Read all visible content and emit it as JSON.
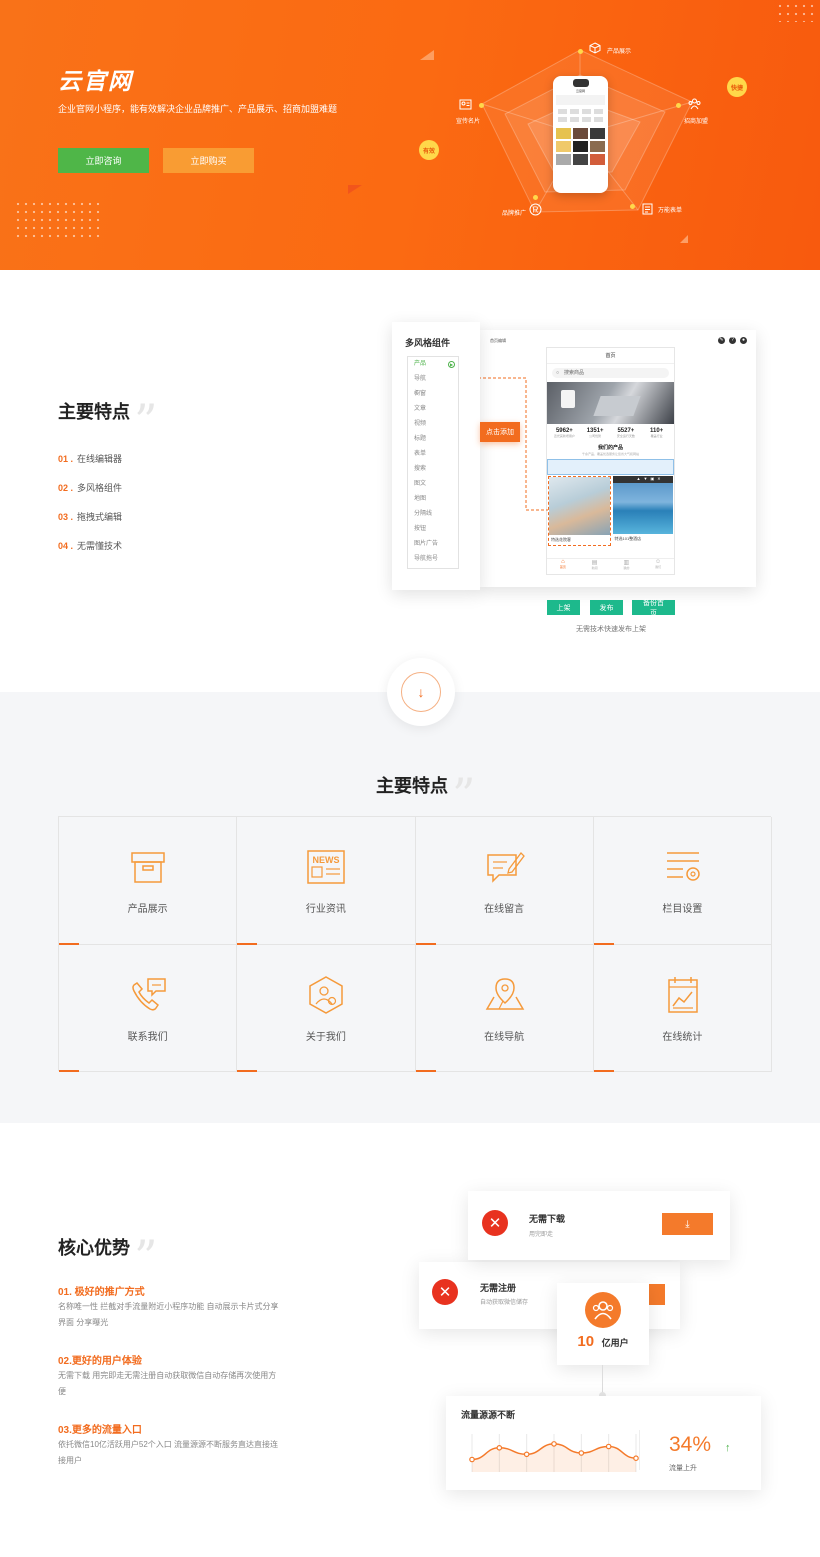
{
  "hero": {
    "brand": "云官网",
    "description": "企业官网小程序，能有效解决企业品牌推广、产品展示、招商加盟难题",
    "consult_label": "立即咨询",
    "buy_label": "立即购买",
    "radar_labels": {
      "product": "产品展示",
      "invest": "招商加盟",
      "form": "万能表单",
      "brand": "品牌推广",
      "card": "宣传名片"
    },
    "badge_fast": "快捷",
    "badge_effective": "有效",
    "phone_title": "云官网"
  },
  "features": {
    "title": "主要特点",
    "items": [
      {
        "num": "01 .",
        "text": "在线编辑器"
      },
      {
        "num": "02 .",
        "text": "多风格组件"
      },
      {
        "num": "03 .",
        "text": "拖拽式编辑"
      },
      {
        "num": "04 .",
        "text": "无需懂技术"
      }
    ]
  },
  "editor": {
    "panel_title": "多风格组件",
    "components": [
      "产品",
      "导航",
      "橱窗",
      "文章",
      "视频",
      "标题",
      "表单",
      "搜索",
      "图文",
      "地图",
      "分隔线",
      "按钮",
      "图片广告",
      "导航拖号"
    ],
    "add_button": "点击添加",
    "toolbar_title": "首页编辑",
    "phone_title": "首页",
    "search_placeholder": "搜索商品",
    "stats": [
      {
        "value": "5962+",
        "label": "近光亮新增用户"
      },
      {
        "value": "1351+",
        "label": "公司优势"
      },
      {
        "value": "5527+",
        "label": "安全运行天数"
      },
      {
        "value": "110+",
        "label": "覆盖行业"
      }
    ],
    "products_title": "我们的产品",
    "products_sub": "千余产品，覆盖优选服务让您省大气和网站",
    "product_names": [
      "特选花院客",
      "特选101整酒店"
    ],
    "tabs": [
      "首页",
      "新闻",
      "我的",
      "我们"
    ],
    "btn_shelf": "上架",
    "btn_publish": "发布",
    "btn_backup": "备份首页",
    "caption": "无需技术快速发布上架"
  },
  "grid": {
    "title": "主要特点",
    "cells": [
      "产品展示",
      "行业资讯",
      "在线留言",
      "栏目设置",
      "联系我们",
      "关于我们",
      "在线导航",
      "在线统计"
    ],
    "news_text": "NEWS"
  },
  "advantages": {
    "title": "核心优势",
    "items": [
      {
        "title": "01. 极好的推广方式",
        "desc": "名称唯一性  拦截对手流量附近小程序功能 自动展示卡片式分享界面 分享曝光"
      },
      {
        "title": "02.更好的用户体验",
        "desc": "无需下载  用完即走无需注册自动获取微信自动存储再次使用方便"
      },
      {
        "title": "03.更多的流量入口",
        "desc": "依托微信10亿活跃用户52个入口  流量源源不断服务直达直接连接用户"
      }
    ],
    "card1_title": "无需下载",
    "card1_sub": "用完即走",
    "card2_title": "无需注册",
    "card2_sub": "自动获取微信储存",
    "users_num": "10",
    "users_unit": "亿用户",
    "traffic_title": "流量源源不断",
    "traffic_pct": "34%",
    "traffic_label": "流量上升",
    "traffic_points": [
      0.25,
      0.7,
      0.45,
      0.85,
      0.5,
      0.75,
      0.3
    ]
  }
}
